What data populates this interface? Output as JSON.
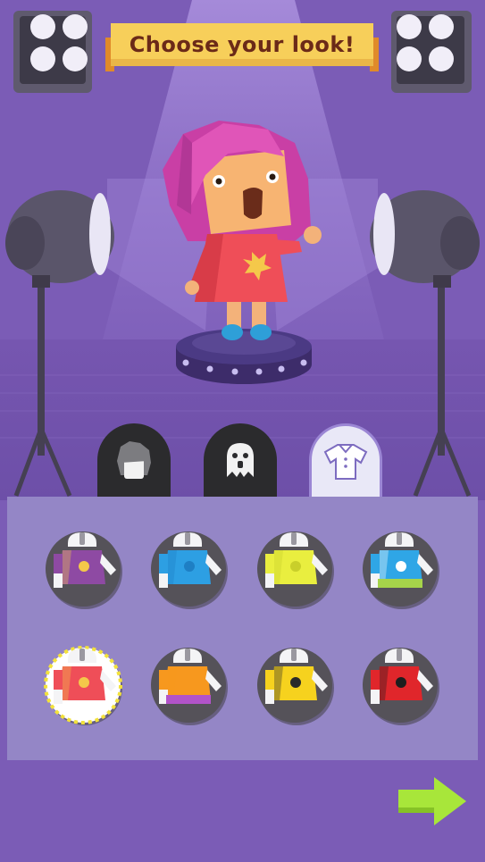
{
  "header": {
    "title": "Choose your look!"
  },
  "tabs": [
    {
      "id": "hair",
      "icon": "hair-icon",
      "active": false
    },
    {
      "id": "face",
      "icon": "ghost-face-icon",
      "active": false
    },
    {
      "id": "outfit",
      "icon": "shirt-icon",
      "active": true
    }
  ],
  "outfits": [
    {
      "icon": "outfit-purple-shirt-icon",
      "shirt": "#8e4aa3",
      "accent": "#f4c84a",
      "pants": null,
      "selected": false
    },
    {
      "icon": "outfit-blue-jacket-icon",
      "shirt": "#2d9fe3",
      "accent": "#1e7fc4",
      "pants": null,
      "selected": false
    },
    {
      "icon": "outfit-yellow-top-icon",
      "shirt": "#e9ee3f",
      "accent": "#c9cf2a",
      "pants": null,
      "selected": false
    },
    {
      "icon": "outfit-striped-shirt-icon",
      "shirt": "#2fa6e6",
      "accent": "#ffffff",
      "pants": "#a6d44a",
      "selected": false
    },
    {
      "icon": "outfit-red-dress-icon",
      "shirt": "#ef4e58",
      "accent": "#f4c84a",
      "pants": null,
      "selected": true
    },
    {
      "icon": "outfit-orange-shirt-icon",
      "shirt": "#f7981e",
      "accent": "#f7981e",
      "pants": "#b253c9",
      "selected": false
    },
    {
      "icon": "outfit-smiley-shirt-icon",
      "shirt": "#f6d21e",
      "accent": "#2a2a2a",
      "pants": null,
      "selected": false
    },
    {
      "icon": "outfit-cat-shirt-icon",
      "shirt": "#e0262b",
      "accent": "#1e1e1e",
      "pants": null,
      "selected": false
    }
  ],
  "colors": {
    "background": "#7b5cb6",
    "panel": "#9486c6",
    "banner": "#f7cf5a",
    "next": "#a8e63a"
  },
  "next_icon": "arrow-right-icon"
}
